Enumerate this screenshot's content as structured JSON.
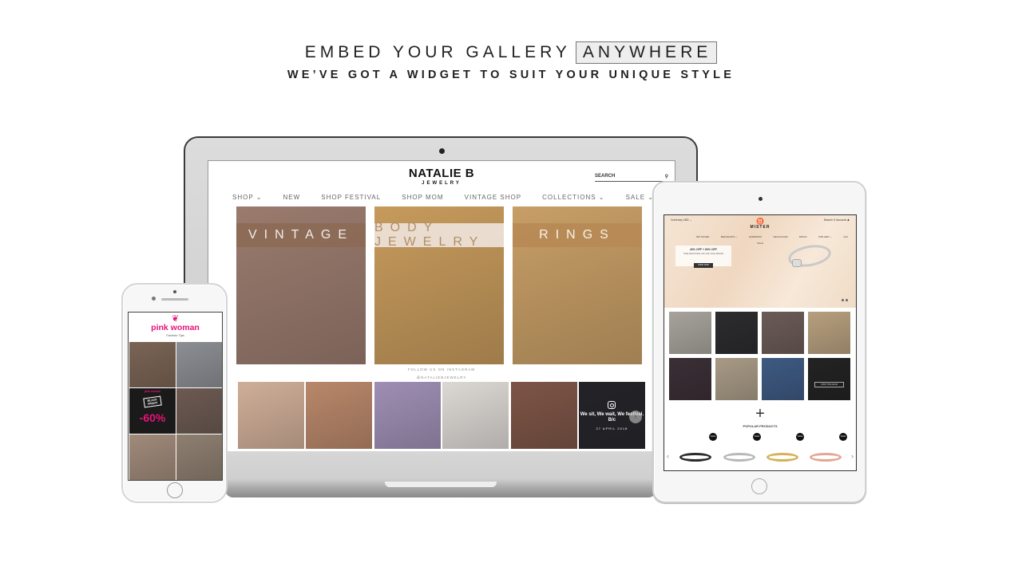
{
  "hero": {
    "title_prefix": "EMBED YOUR GALLERY",
    "title_highlight": "ANYWHERE",
    "subtitle": "WE’VE GOT A WIDGET TO SUIT YOUR UNIQUE STYLE"
  },
  "laptop_site": {
    "logo": "NATALIE B",
    "logo_sub": "JEWELRY",
    "search_label": "SEARCH",
    "search_icon": "search-icon",
    "nav": [
      {
        "label": "SHOP ⌄"
      },
      {
        "label": "NEW"
      },
      {
        "label": "SHOP FESTIVAL"
      },
      {
        "label": "SHOP MOM"
      },
      {
        "label": "VINTAGE SHOP"
      },
      {
        "label": "COLLECTIONS ⌄"
      },
      {
        "label": "SALE ⌄"
      }
    ],
    "categories": [
      {
        "label": "VINTAGE",
        "band_color": "#8c6a55",
        "bg": "#9a7b6e"
      },
      {
        "label": "BODY JEWELRY",
        "band_color": "#f1e7df",
        "text_color": "#b08f6c",
        "bg": "#c69a5c"
      },
      {
        "label": "RINGS",
        "band_color": "#b88a55",
        "bg": "#c79e66"
      }
    ],
    "follow_text": "FOLLOW US ON INSTAGRAM",
    "handle": "@NATALIEBJEWELRY",
    "instagram_tiles": [
      {
        "bg": "#cfae98"
      },
      {
        "bg": "#b8876a"
      },
      {
        "bg": "#9e8fb3"
      },
      {
        "bg": "#dcd8d4"
      },
      {
        "bg": "#7d5547"
      },
      {
        "bg": "#3a3536"
      }
    ],
    "last_tile": {
      "icon": "instagram-icon",
      "caption": "We sit, We wait, We festival. B/c",
      "date": "27 APRIL 2018",
      "next_icon": "chevron-right-icon"
    }
  },
  "phone_site": {
    "logo": "pink woman",
    "tagline": "Fashion Tips",
    "brand_color": "#e6127a",
    "tiles": [
      {
        "bg": "#7a6455"
      },
      {
        "bg": "#8b8e93"
      },
      {
        "type": "promo",
        "brand": "pink woman",
        "badge": "BLACK FRIDAY",
        "discount": "-60%"
      },
      {
        "bg": "#6c5a52"
      },
      {
        "bg": "#a08a7a"
      },
      {
        "bg": "#8e7f70"
      }
    ]
  },
  "tablet_site": {
    "currency_label": "Currency",
    "currency_value": "USD ⌄",
    "search_label": "Search",
    "account_label": "Account",
    "logo": "MISTER",
    "nav": [
      "925 SILVER",
      "BRACELETS ⌄",
      "EARRINGS",
      "NECKLACES",
      "RINGS",
      "FOR HER ⌄",
      "Cart"
    ],
    "nav_sale": "SALE",
    "promo": {
      "title": "40% OFF + 60% OFF",
      "subtitle": "TAKE ADDITIONAL 40% OFF SALE PRICES",
      "button": "SHOP NOW"
    },
    "grid_tiles": [
      {
        "bg": "#a7a39c"
      },
      {
        "bg": "#2c2c2e"
      },
      {
        "bg": "#6b5b57"
      },
      {
        "bg": "#b69f7e"
      },
      {
        "bg": "#3b2f36"
      },
      {
        "bg": "#a89a86"
      },
      {
        "bg": "#3e5a82"
      },
      {
        "bg": "#232323",
        "button": "SHOP THE GRAM"
      }
    ],
    "plus_icon": "plus-icon",
    "popular_label": "POPULAR PRODUCTS",
    "products": [
      {
        "badge": "SALE",
        "color": "#2a2a2a"
      },
      {
        "badge": "SALE",
        "color": "#b8b8b8"
      },
      {
        "badge": "SALE",
        "color": "#d4b25a"
      },
      {
        "badge": "SALE",
        "color": "#e3a796"
      }
    ],
    "prev_icon": "‹",
    "next_icon": "›"
  }
}
